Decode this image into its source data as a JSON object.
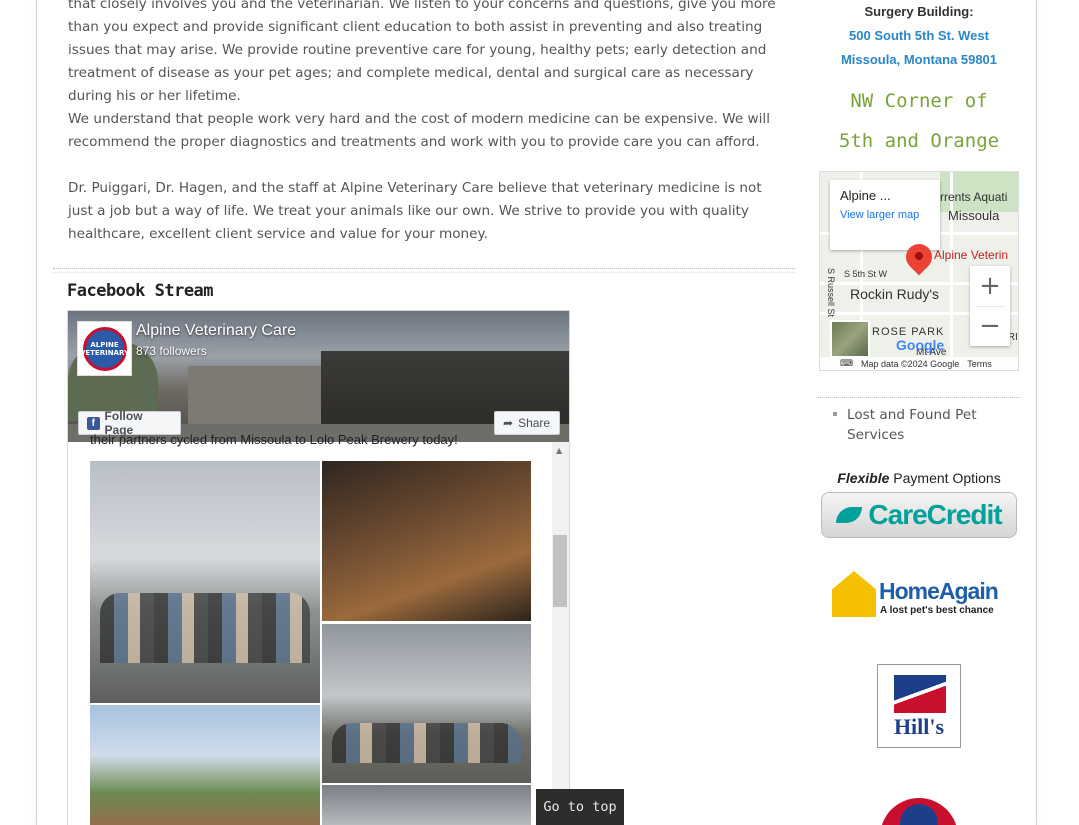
{
  "content": {
    "paragraphs": [
      "that closely involves you and the veterinarian. We listen to your concerns and questions, give you more than you expect and provide significant client education to both assist in preventing and also treating issues that may arise. We provide routine preventive care for young, healthy pets; early detection and treatment of disease as your pet ages; and complete medical, dental and surgical care as necessary during his or her lifetime.",
      "We understand that people work very hard and the cost of modern medicine can be expensive. We will recommend the proper diagnostics and treatments and work with you to provide care you can afford.",
      "Dr. Puiggari, Dr. Hagen, and the staff at Alpine Veterinary Care believe that veterinary medicine is not just a job but a way of life. We treat your animals like our own. We strive to provide you with quality healthcare, excellent client service and value for your money."
    ],
    "facebook_heading": "Facebook Stream"
  },
  "facebook": {
    "page_name": "Alpine Veterinary Care",
    "followers": "873 followers",
    "logo_text": "ALPINE VETERINARY",
    "follow_label": "Follow Page",
    "share_label": "Share",
    "post_text": "their partners cycled from Missoula to Lolo Peak Brewery today!"
  },
  "go_top_label": "Go to top",
  "sidebar": {
    "surgery_label": "Surgery Building:",
    "address_line1": "500 South 5th St. West",
    "address_line2": "Missoula, Montana 59801",
    "corner_line1": "NW Corner of",
    "corner_line2": "5th and Orange",
    "map": {
      "card_title": "Alpine ...",
      "card_link": "View larger map",
      "place_aquatic": "rrents Aquati",
      "place_missoula": "Missoula",
      "place_alpine": "Alpine Veterin",
      "street_5th": "S 5th St W",
      "place_rockin": "Rockin Rudy's",
      "street_russell": "S Russell St",
      "place_rose_park": "ROSE PARK",
      "place_distri": "U\nDISTRI",
      "street_mt_ave": "Mt Ave",
      "google": "Google",
      "map_data": "Map data ©2024 Google",
      "terms": "Terms"
    },
    "lost_found": "Lost and Found Pet Services",
    "carecredit": {
      "tagline_bold": "Flexible",
      "tagline_rest": " Payment Options",
      "brand": "CareCredit"
    },
    "homeagain": {
      "brand": "HomeAgain",
      "tagline": "A lost pet's best chance"
    },
    "hills_text": "Hill's"
  }
}
